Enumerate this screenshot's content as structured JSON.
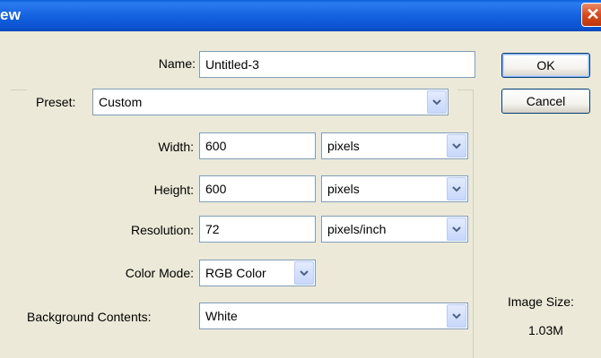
{
  "window": {
    "title": "ew",
    "close_glyph": "✕"
  },
  "form": {
    "name_label": "Name:",
    "name_value": "Untitled-3",
    "preset_label": "Preset:",
    "preset_value": "Custom",
    "width_label": "Width:",
    "width_value": "600",
    "width_unit": "pixels",
    "height_label": "Height:",
    "height_value": "600",
    "height_unit": "pixels",
    "resolution_label": "Resolution:",
    "resolution_value": "72",
    "resolution_unit": "pixels/inch",
    "color_mode_label": "Color Mode:",
    "color_mode_value": "RGB Color",
    "background_label": "Background Contents:",
    "background_value": "White"
  },
  "buttons": {
    "ok_label": "OK",
    "cancel_label": "Cancel"
  },
  "info": {
    "image_size_label": "Image Size:",
    "image_size_value": "1.03M"
  }
}
